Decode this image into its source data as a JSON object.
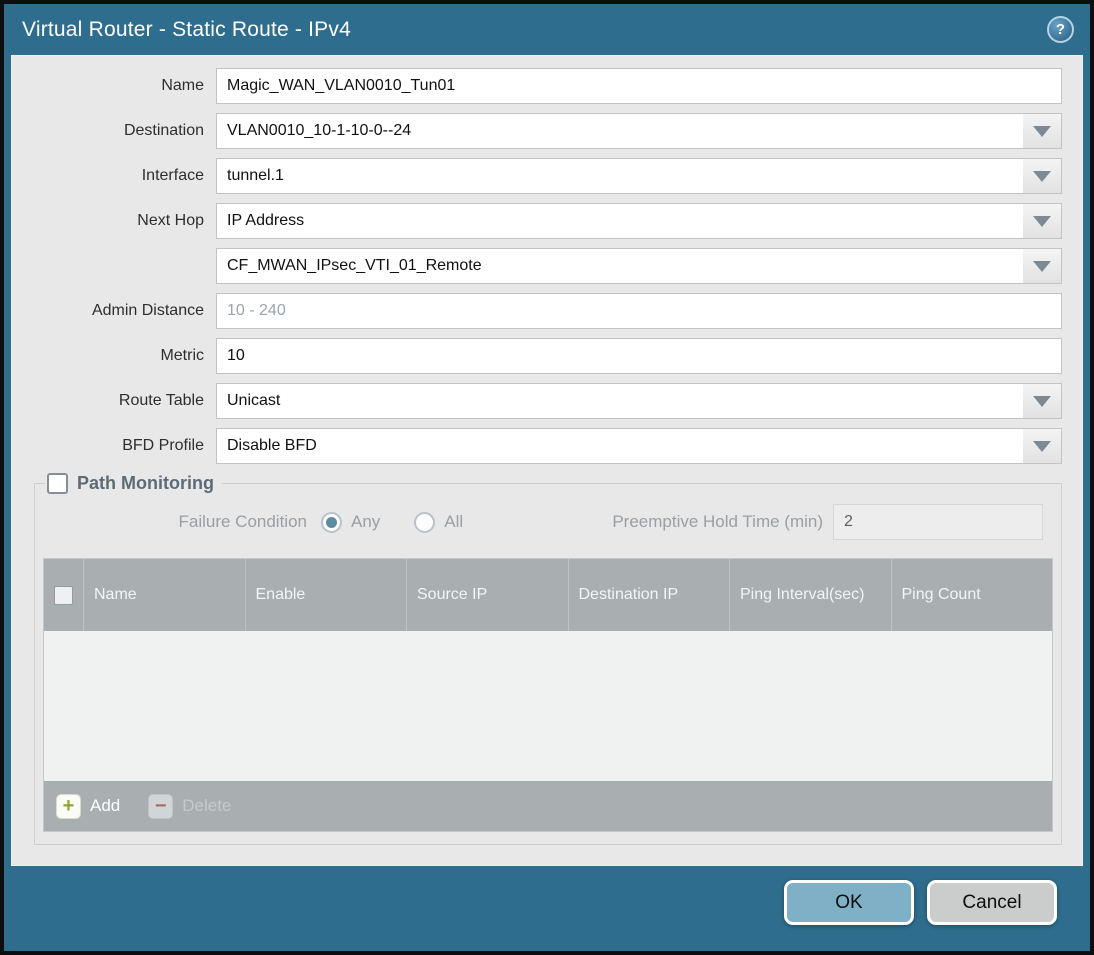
{
  "titlebar": {
    "title": "Virtual Router - Static Route - IPv4",
    "help_glyph": "?"
  },
  "form": {
    "name": {
      "label": "Name",
      "value": "Magic_WAN_VLAN0010_Tun01"
    },
    "destination": {
      "label": "Destination",
      "value": "VLAN0010_10-1-10-0--24"
    },
    "interface": {
      "label": "Interface",
      "value": "tunnel.1"
    },
    "next_hop": {
      "label": "Next Hop",
      "value": "IP Address"
    },
    "next_hop_address": {
      "value": "CF_MWAN_IPsec_VTI_01_Remote"
    },
    "admin_distance": {
      "label": "Admin Distance",
      "placeholder": "10 - 240"
    },
    "metric": {
      "label": "Metric",
      "value": "10"
    },
    "route_table": {
      "label": "Route Table",
      "value": "Unicast"
    },
    "bfd_profile": {
      "label": "BFD Profile",
      "value": "Disable BFD"
    }
  },
  "path_monitoring": {
    "title": "Path Monitoring",
    "enabled": false,
    "failure_condition": {
      "label": "Failure Condition",
      "options": [
        {
          "label": "Any",
          "selected": true
        },
        {
          "label": "All",
          "selected": false
        }
      ]
    },
    "preemptive_hold_time": {
      "label": "Preemptive Hold Time (min)",
      "value": "2"
    },
    "table": {
      "columns": [
        "Name",
        "Enable",
        "Source IP",
        "Destination IP",
        "Ping Interval(sec)",
        "Ping Count"
      ],
      "rows": [],
      "select_all_checked": false
    },
    "toolbar": {
      "add": "Add",
      "delete": "Delete",
      "add_glyph": "+",
      "delete_glyph": "−"
    }
  },
  "footer": {
    "ok": "OK",
    "cancel": "Cancel"
  },
  "colors": {
    "titlebar_bg": "#2e6d8d",
    "panel_bg": "#e8e8e8",
    "table_header_bg": "#a9aeb1",
    "ok_button_bg": "#7fb0c6",
    "cancel_button_bg": "#cbcccc",
    "add_icon_green": "#8aa43c",
    "delete_icon_red": "#a56f60",
    "radio_selected": "#5f8ba1"
  }
}
